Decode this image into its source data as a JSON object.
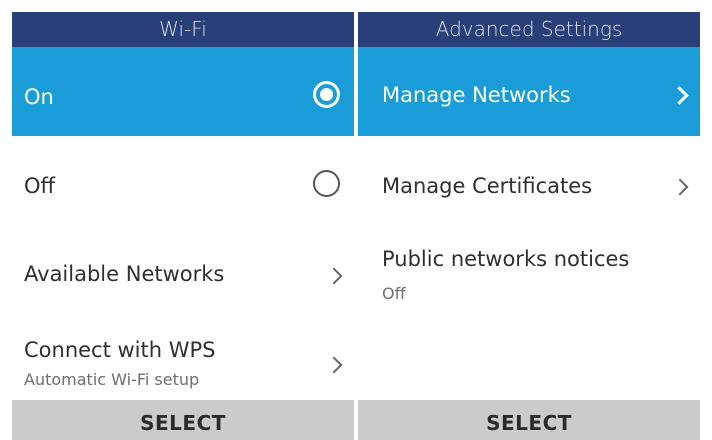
{
  "left_screen": {
    "header": "Wi-Fi",
    "items": [
      {
        "label": "On",
        "control": "radio",
        "checked": true,
        "selected": true
      },
      {
        "label": "Off",
        "control": "radio",
        "checked": false,
        "selected": false
      },
      {
        "label": "Available Networks",
        "control": "chevron",
        "selected": false
      },
      {
        "label": "Connect with WPS",
        "sublabel": "Automatic Wi-Fi setup",
        "control": "chevron",
        "selected": false
      }
    ],
    "softkey": "SELECT"
  },
  "right_screen": {
    "header": "Advanced Settings",
    "items": [
      {
        "label": "Manage Networks",
        "control": "chevron",
        "selected": true
      },
      {
        "label": "Manage Certificates",
        "control": "chevron",
        "selected": false
      },
      {
        "label": "Public networks notices",
        "sublabel": "Off",
        "selected": false
      }
    ],
    "softkey": "SELECT"
  },
  "colors": {
    "header_bg": "#283f7a",
    "selected_bg": "#1a9cd8",
    "softkey_bg": "#cbcbcb"
  },
  "icons": [
    "radio-checked-icon",
    "radio-unchecked-icon",
    "chevron-right-icon"
  ]
}
